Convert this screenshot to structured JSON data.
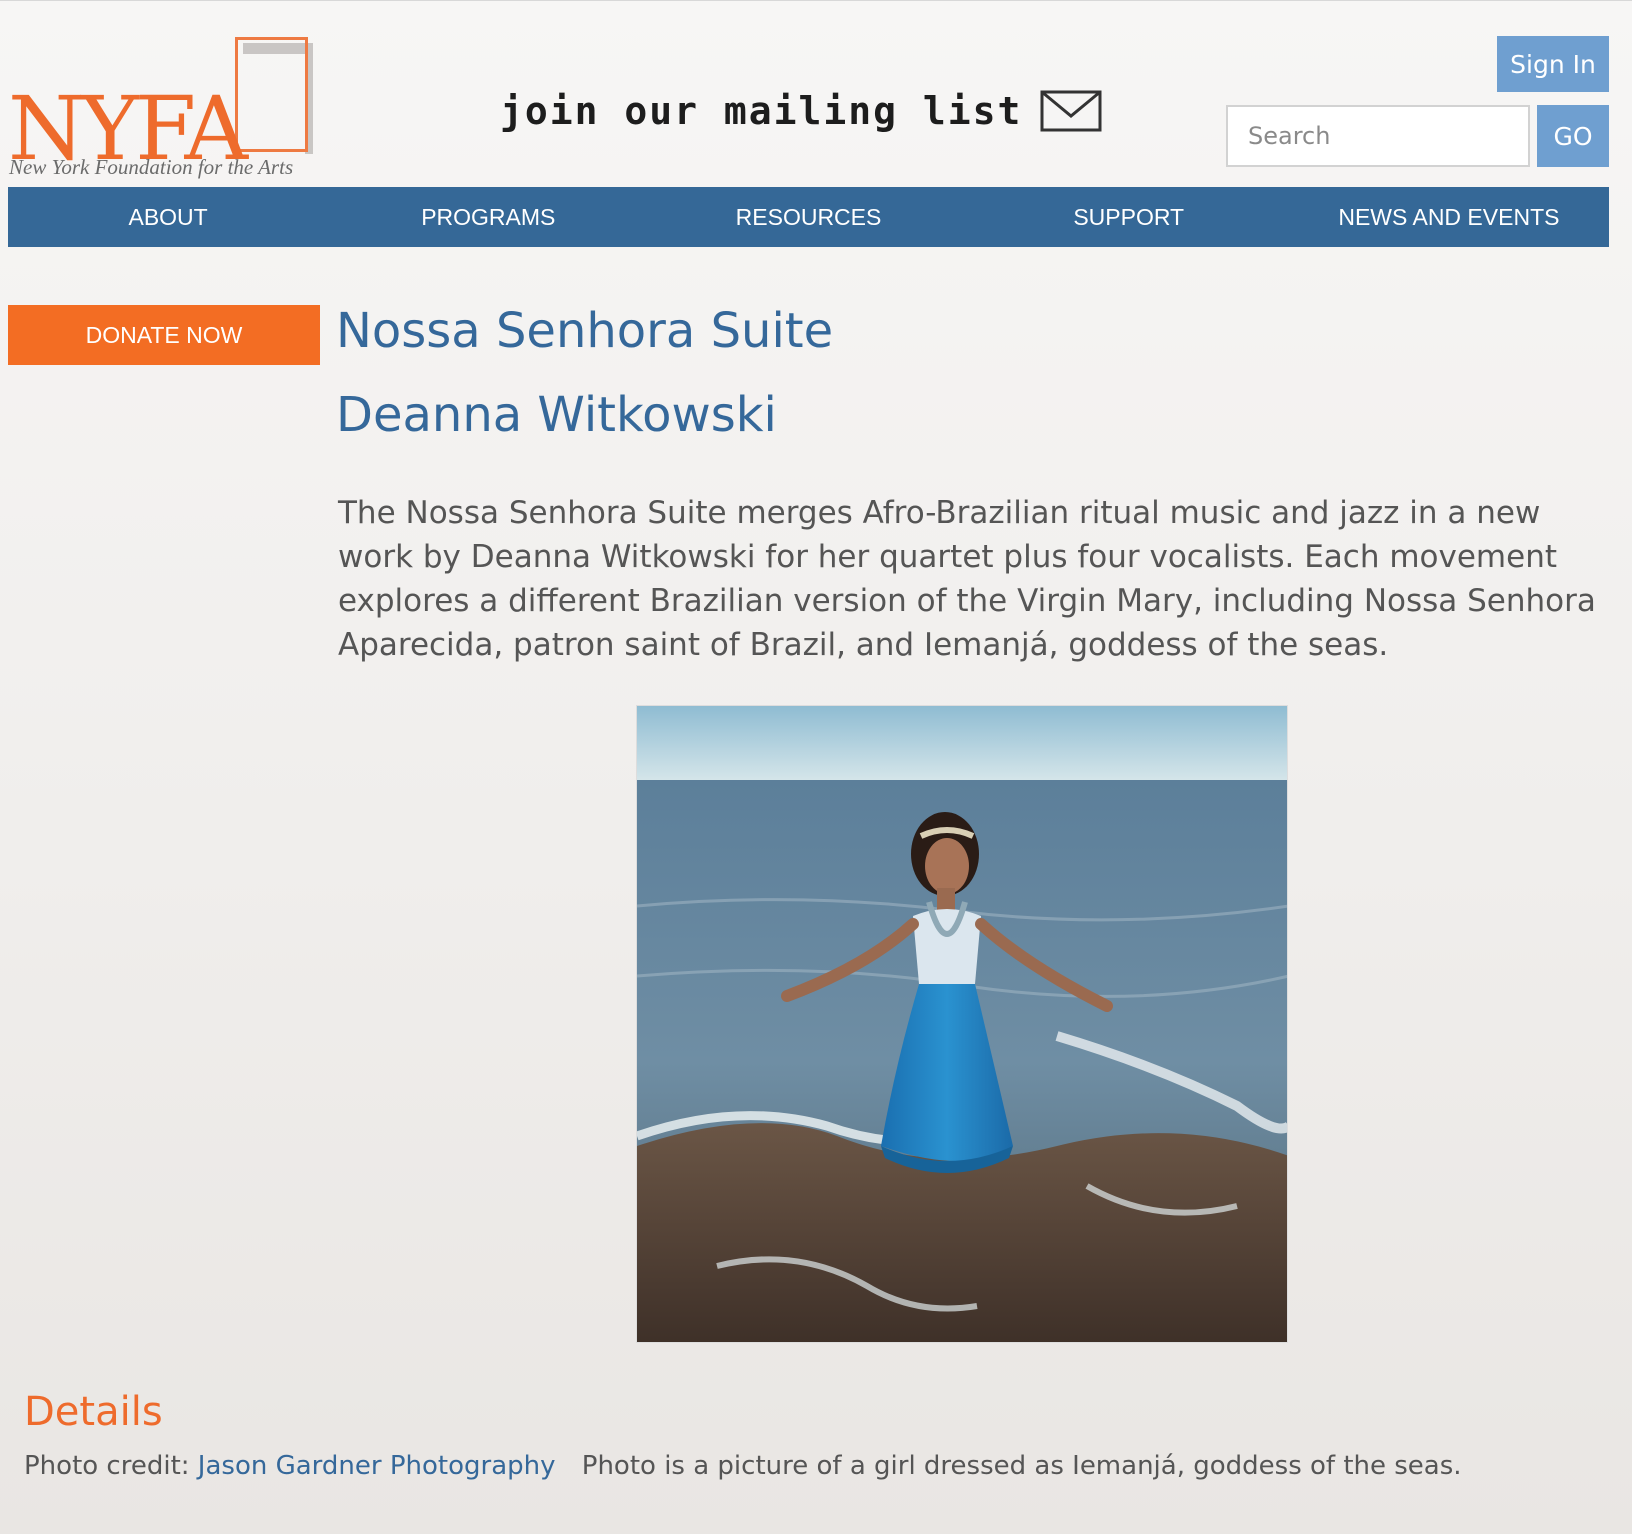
{
  "logo": {
    "text": "NYFA",
    "subtitle": "New York Foundation for the Arts"
  },
  "header": {
    "mailing_list_label": "join our mailing list",
    "sign_in_label": "Sign In",
    "search_placeholder": "Search",
    "go_label": "GO"
  },
  "nav": {
    "items": [
      {
        "label": "ABOUT"
      },
      {
        "label": "PROGRAMS"
      },
      {
        "label": "RESOURCES"
      },
      {
        "label": "SUPPORT"
      },
      {
        "label": "NEWS AND EVENTS"
      }
    ]
  },
  "sidebar": {
    "donate_label": "DONATE NOW"
  },
  "main": {
    "title": "Nossa Senhora Suite",
    "artist": "Deanna Witkowski",
    "description": "The Nossa Senhora Suite merges Afro-Brazilian ritual music and jazz in a new work by Deanna Witkowski for her quartet plus four vocalists. Each movement explores a different Brazilian version of the Virgin Mary, including Nossa Senhora Aparecida, patron saint of Brazil, and Iemanjá, goddess of the seas."
  },
  "details": {
    "heading": "Details",
    "photo_credit_label": "Photo credit:",
    "photo_credit_link": "Jason Gardner Photography",
    "caption": "Photo is a picture of a girl dressed as Iemanjá, goddess of the seas."
  },
  "icons": {
    "mail": "envelope-icon"
  },
  "colors": {
    "brand_orange": "#ee6b2c",
    "nav_blue": "#356897",
    "button_blue": "#6f9fd0",
    "donate_orange": "#f36d23",
    "title_blue": "#35689a"
  }
}
